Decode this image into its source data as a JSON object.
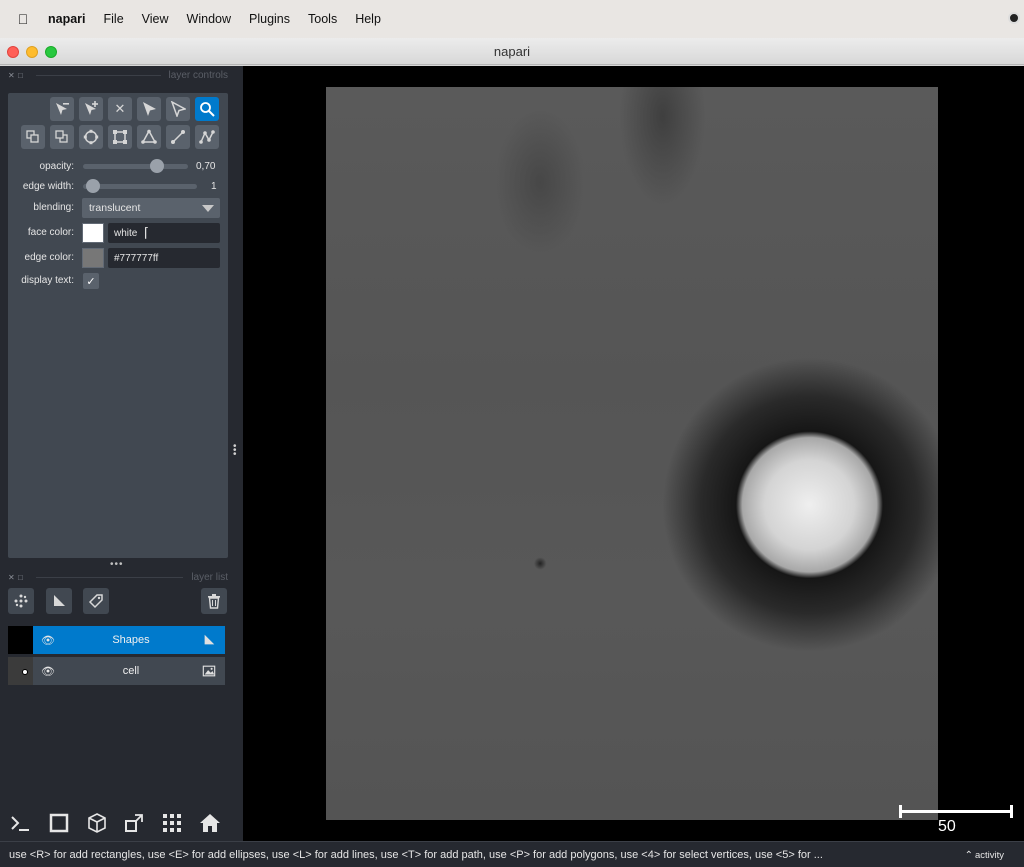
{
  "menubar": {
    "app_name": "napari",
    "items": [
      "File",
      "View",
      "Window",
      "Plugins",
      "Tools",
      "Help"
    ]
  },
  "window": {
    "title": "napari"
  },
  "layer_controls": {
    "dock_title": "layer controls",
    "opacity": {
      "label": "opacity:",
      "value": "0,70",
      "fraction": 0.7
    },
    "edge_width": {
      "label": "edge width:",
      "value": "1",
      "fraction": 0.0
    },
    "blending": {
      "label": "blending:",
      "value": "translucent"
    },
    "face_color": {
      "label": "face color:",
      "value": "white",
      "swatch": "#ffffff"
    },
    "edge_color": {
      "label": "edge color:",
      "value": "#777777ff",
      "swatch": "#777777"
    },
    "display_text": {
      "label": "display text:",
      "checked": true
    }
  },
  "layer_list": {
    "dock_title": "layer list",
    "layers": [
      {
        "name": "Shapes",
        "selected": true,
        "type_icon": "shapes-layer-icon"
      },
      {
        "name": "cell",
        "selected": false,
        "type_icon": "image-layer-icon"
      }
    ]
  },
  "canvas": {
    "scalebar_label": "50"
  },
  "statusbar": {
    "message": "use <R> for add rectangles, use <E> for add ellipses, use <L> for add lines, use <T> for add path, use <P> for add polygons, use <4> for select vertices, use <5> for ...",
    "activity_label": "activity"
  },
  "colors": {
    "accent": "#007acc",
    "panel": "#414851",
    "background": "#262930"
  }
}
